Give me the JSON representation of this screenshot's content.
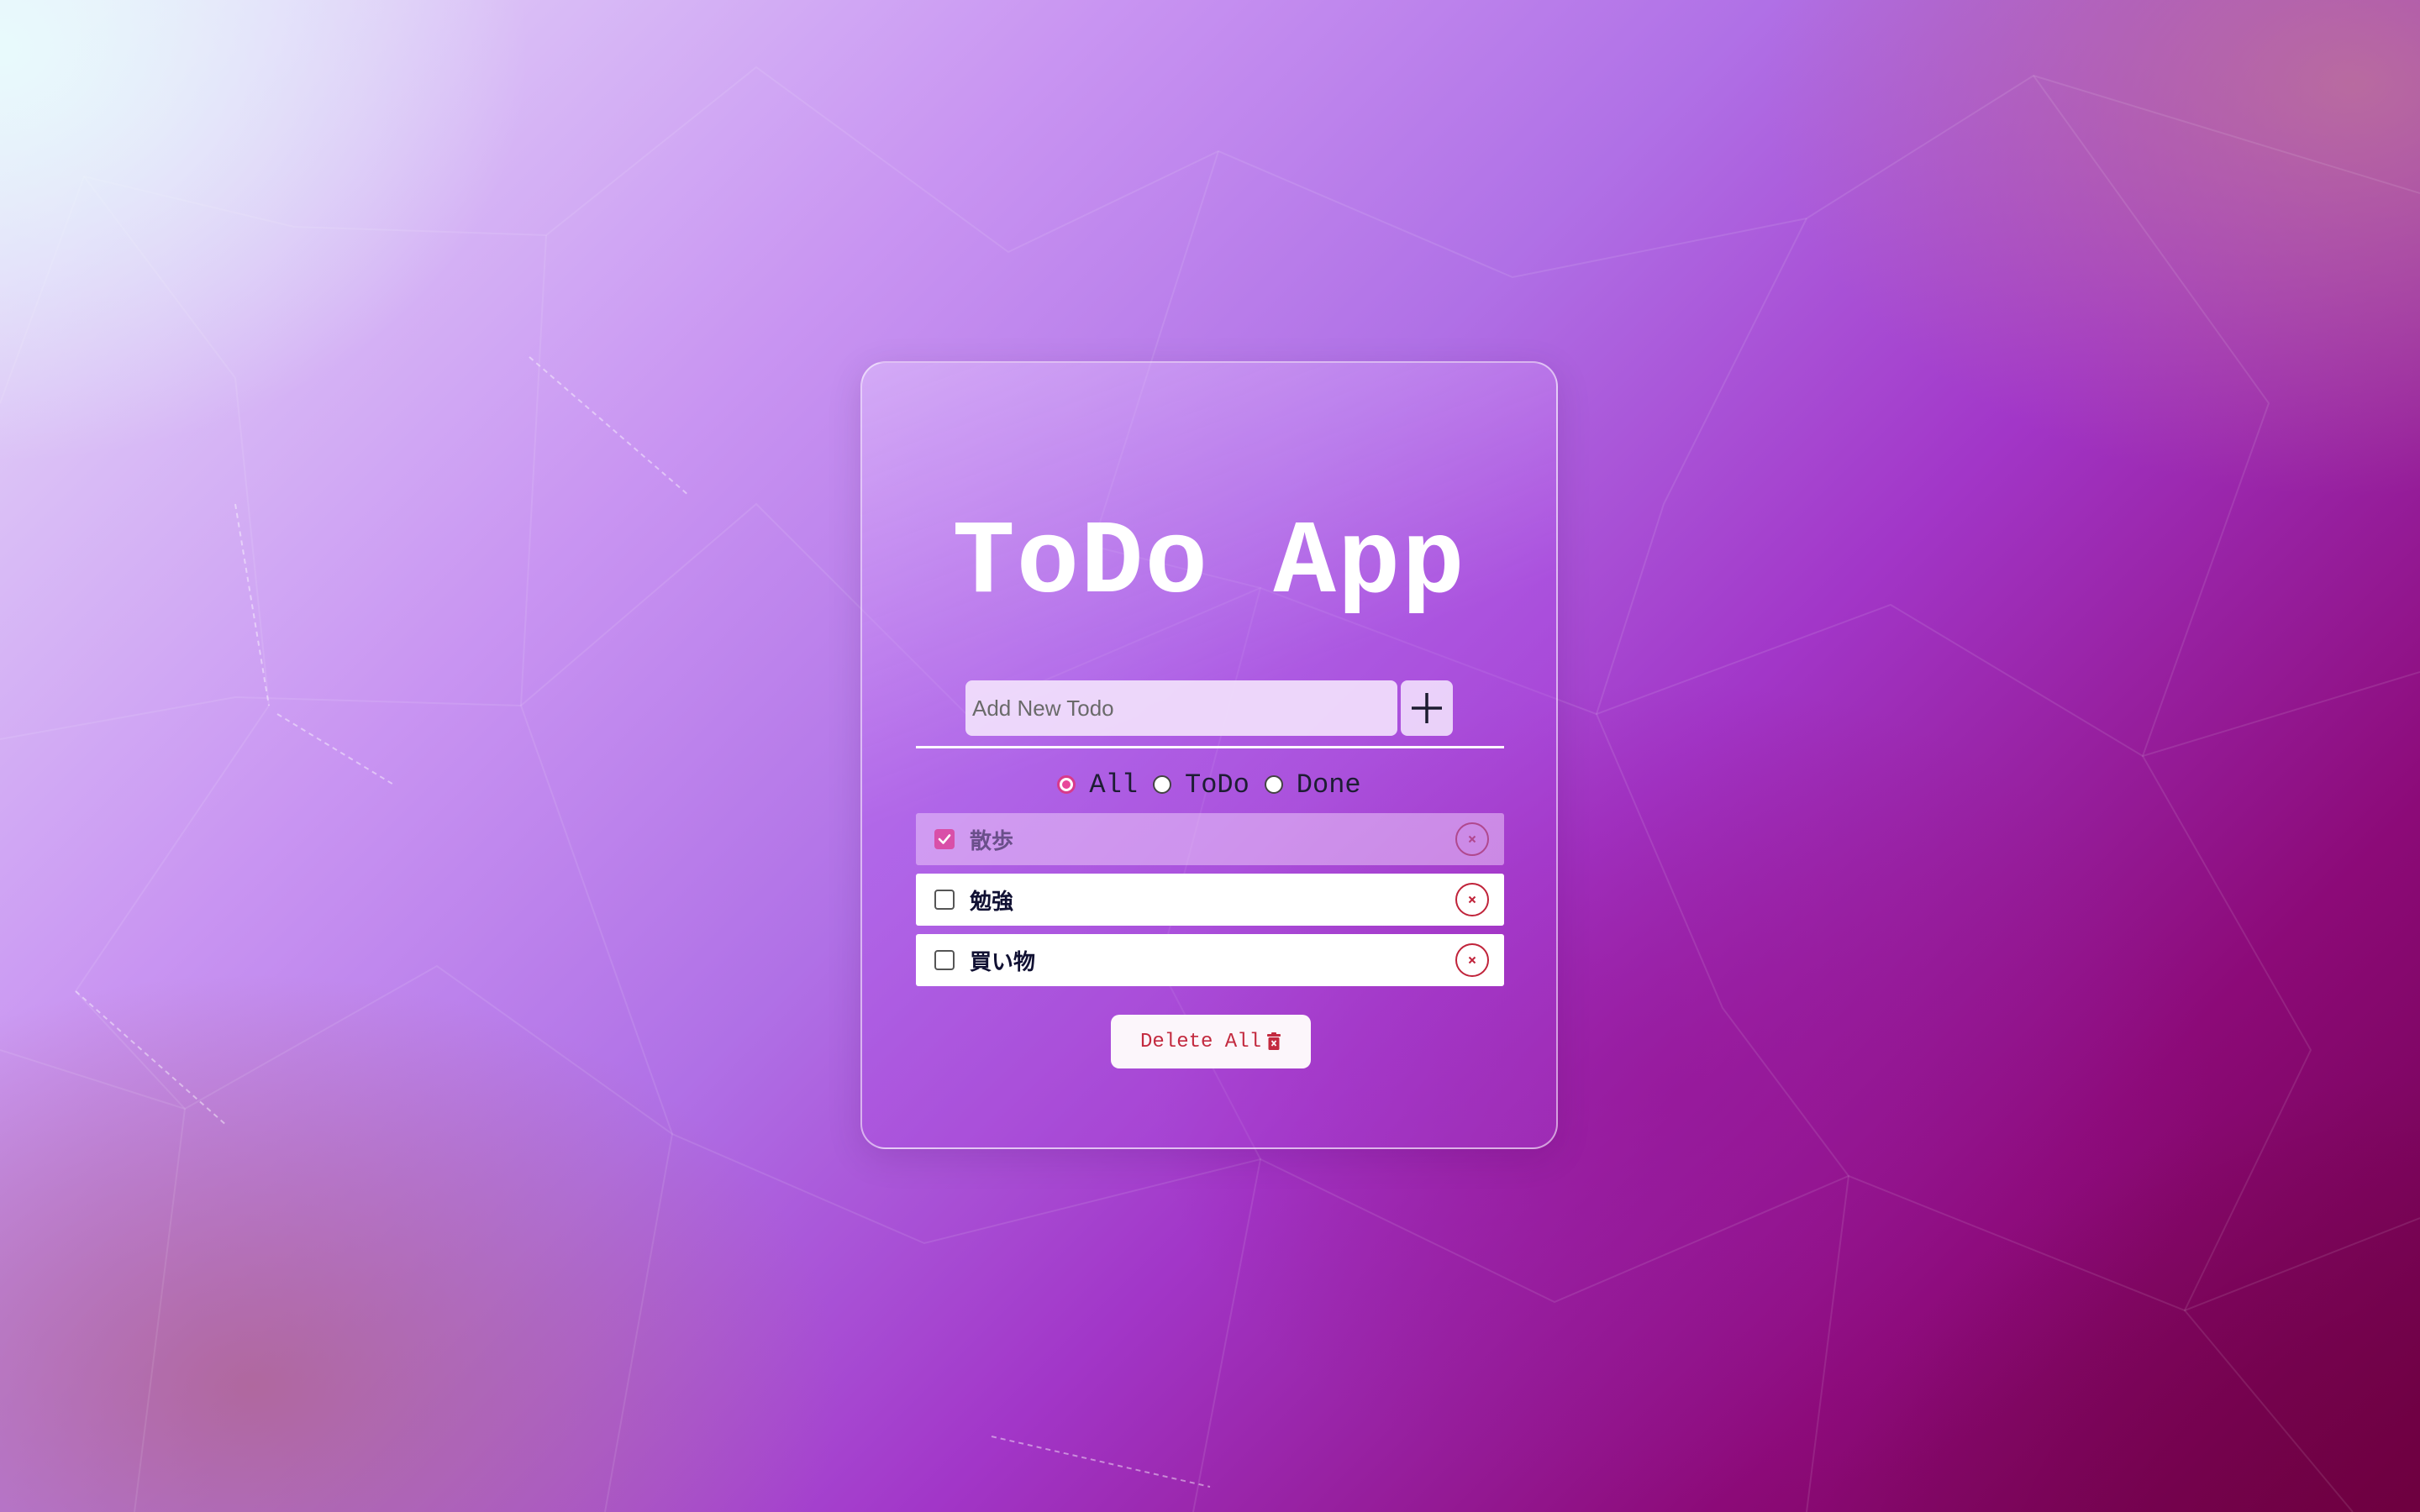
{
  "app": {
    "title": "ToDo App"
  },
  "add_form": {
    "placeholder": "Add New Todo",
    "value": "",
    "add_icon": "plus-icon"
  },
  "filters": {
    "selected": "All",
    "options": [
      {
        "label": "All",
        "checked": true
      },
      {
        "label": "ToDo",
        "checked": false
      },
      {
        "label": "Done",
        "checked": false
      }
    ]
  },
  "todos": [
    {
      "label": "散歩",
      "done": true
    },
    {
      "label": "勉強",
      "done": false
    },
    {
      "label": "買い物",
      "done": false
    }
  ],
  "delete_all": {
    "label": "Delete All",
    "icon": "trash-icon"
  },
  "colors": {
    "accent": "#d94fa8",
    "danger": "#c0233a",
    "title": "#ffffff"
  }
}
